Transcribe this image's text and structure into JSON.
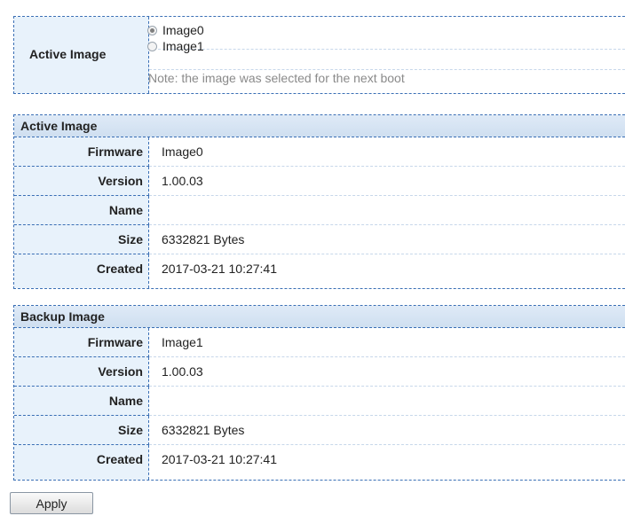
{
  "active_image_select": {
    "label": "Active Image",
    "options": [
      {
        "label": "Image0",
        "selected": true
      },
      {
        "label": "Image1",
        "selected": false
      }
    ],
    "note": "Note: the image was selected for the next boot"
  },
  "active_section": {
    "title": "Active Image",
    "rows": [
      {
        "key": "Firmware",
        "value": "Image0"
      },
      {
        "key": "Version",
        "value": "1.00.03"
      },
      {
        "key": "Name",
        "value": ""
      },
      {
        "key": "Size",
        "value": "6332821 Bytes"
      },
      {
        "key": "Created",
        "value": "2017-03-21 10:27:41"
      }
    ]
  },
  "backup_section": {
    "title": "Backup Image",
    "rows": [
      {
        "key": "Firmware",
        "value": "Image1"
      },
      {
        "key": "Version",
        "value": "1.00.03"
      },
      {
        "key": "Name",
        "value": ""
      },
      {
        "key": "Size",
        "value": "6332821 Bytes"
      },
      {
        "key": "Created",
        "value": "2017-03-21 10:27:41"
      }
    ]
  },
  "apply_label": "Apply"
}
